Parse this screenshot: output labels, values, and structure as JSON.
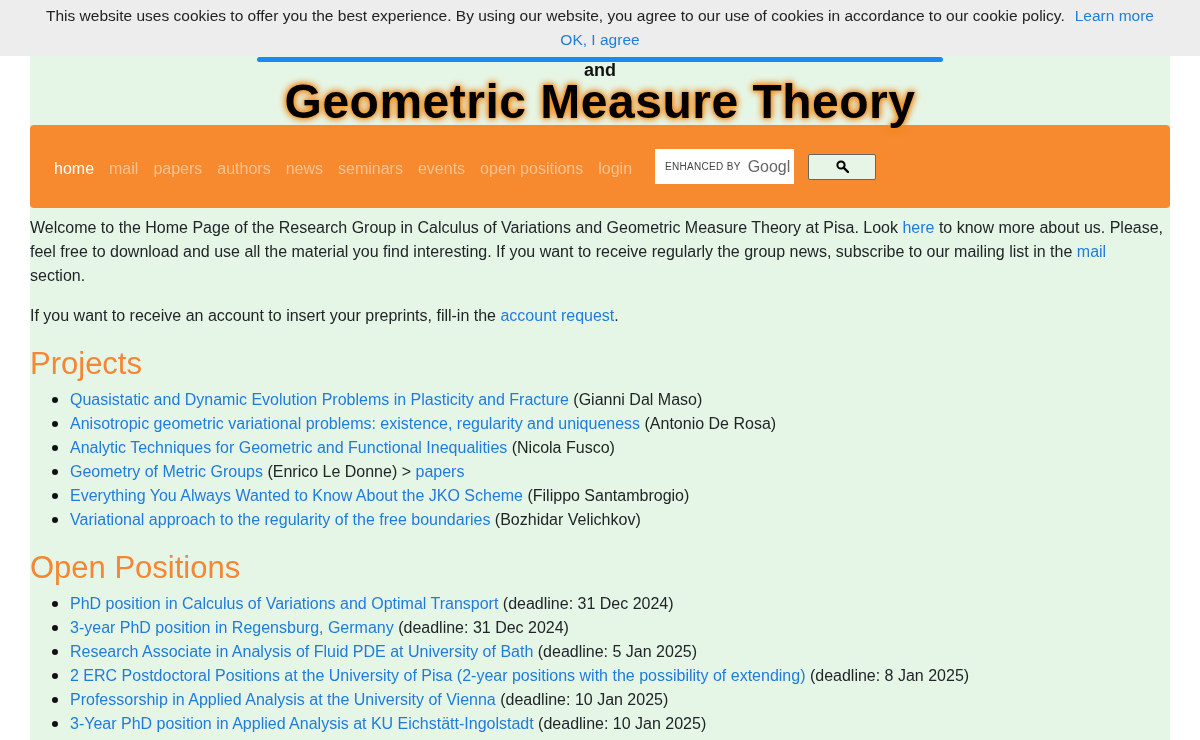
{
  "cookie_bar": {
    "message": "This website uses cookies to offer you the best experience. By using our website, you agree to our use of cookies in accordance to our cookie policy.",
    "learn_more": "Learn more",
    "accept": "OK, I agree"
  },
  "banner": {
    "subtitle": "and",
    "title": "Geometric Measure Theory"
  },
  "nav": {
    "items": [
      {
        "label": "home",
        "selected": true
      },
      {
        "label": "mail",
        "selected": false
      },
      {
        "label": "papers",
        "selected": false
      },
      {
        "label": "authors",
        "selected": false
      },
      {
        "label": "news",
        "selected": false
      },
      {
        "label": "seminars",
        "selected": false
      },
      {
        "label": "events",
        "selected": false
      },
      {
        "label": "open positions",
        "selected": false
      },
      {
        "label": "login",
        "selected": false
      }
    ],
    "search": {
      "watermark_label": "ENHANCED BY",
      "watermark_brand": "Googl"
    }
  },
  "intro": [
    [
      {
        "kind": "text",
        "text": "Welcome to the Home Page of the Research Group in Calculus of Variations and Geometric Measure Theory at Pisa. Look "
      },
      {
        "kind": "link",
        "text": "here"
      },
      {
        "kind": "text",
        "text": " to know more about us. Please, feel free to download and use all the material you find interesting. If you want to receive regularly the group news, subscribe to our mailing list in the "
      },
      {
        "kind": "link",
        "text": "mail"
      },
      {
        "kind": "text",
        "text": " section."
      }
    ],
    [
      {
        "kind": "text",
        "text": "If you want to receive an account to insert your preprints, fill-in the "
      },
      {
        "kind": "link",
        "text": "account request"
      },
      {
        "kind": "text",
        "text": "."
      }
    ]
  ],
  "sections": [
    {
      "heading": "Projects",
      "items": [
        [
          {
            "kind": "link",
            "text": "Quasistatic and Dynamic Evolution Problems in Plasticity and Fracture"
          },
          {
            "kind": "text",
            "text": " (Gianni Dal Maso)"
          }
        ],
        [
          {
            "kind": "link",
            "text": "Anisotropic geometric variational problems: existence, regularity and uniqueness"
          },
          {
            "kind": "text",
            "text": " (Antonio De Rosa)"
          }
        ],
        [
          {
            "kind": "link",
            "text": "Analytic Techniques for Geometric and Functional Inequalities"
          },
          {
            "kind": "text",
            "text": " (Nicola Fusco)"
          }
        ],
        [
          {
            "kind": "link",
            "text": "Geometry of Metric Groups"
          },
          {
            "kind": "text",
            "text": " (Enrico Le Donne) > "
          },
          {
            "kind": "link",
            "text": "papers"
          }
        ],
        [
          {
            "kind": "link",
            "text": "Everything You Always Wanted to Know About the JKO Scheme"
          },
          {
            "kind": "text",
            "text": " (Filippo Santambrogio)"
          }
        ],
        [
          {
            "kind": "link",
            "text": "Variational approach to the regularity of the free boundaries"
          },
          {
            "kind": "text",
            "text": " (Bozhidar Velichkov)"
          }
        ]
      ]
    },
    {
      "heading": "Open Positions",
      "items": [
        [
          {
            "kind": "link",
            "text": "PhD position in Calculus of Variations and Optimal Transport"
          },
          {
            "kind": "text",
            "text": " (deadline: 31 Dec 2024)"
          }
        ],
        [
          {
            "kind": "link",
            "text": "3-year PhD position in Regensburg, Germany"
          },
          {
            "kind": "text",
            "text": " (deadline: 31 Dec 2024)"
          }
        ],
        [
          {
            "kind": "link",
            "text": "Research Associate in Analysis of Fluid PDE at University of Bath"
          },
          {
            "kind": "text",
            "text": " (deadline: 5 Jan 2025)"
          }
        ],
        [
          {
            "kind": "link",
            "text": "2 ERC Postdoctoral Positions at the University of Pisa (2-year positions with the possibility of extending)"
          },
          {
            "kind": "text",
            "text": " (deadline: 8 Jan 2025)"
          }
        ],
        [
          {
            "kind": "link",
            "text": "Professorship in Applied Analysis at the University of Vienna"
          },
          {
            "kind": "text",
            "text": " (deadline: 10 Jan 2025)"
          }
        ],
        [
          {
            "kind": "link",
            "text": "3-Year PhD position in Applied Analysis at KU Eichstätt-Ingolstadt"
          },
          {
            "kind": "text",
            "text": " (deadline: 10 Jan 2025)"
          }
        ]
      ]
    }
  ]
}
